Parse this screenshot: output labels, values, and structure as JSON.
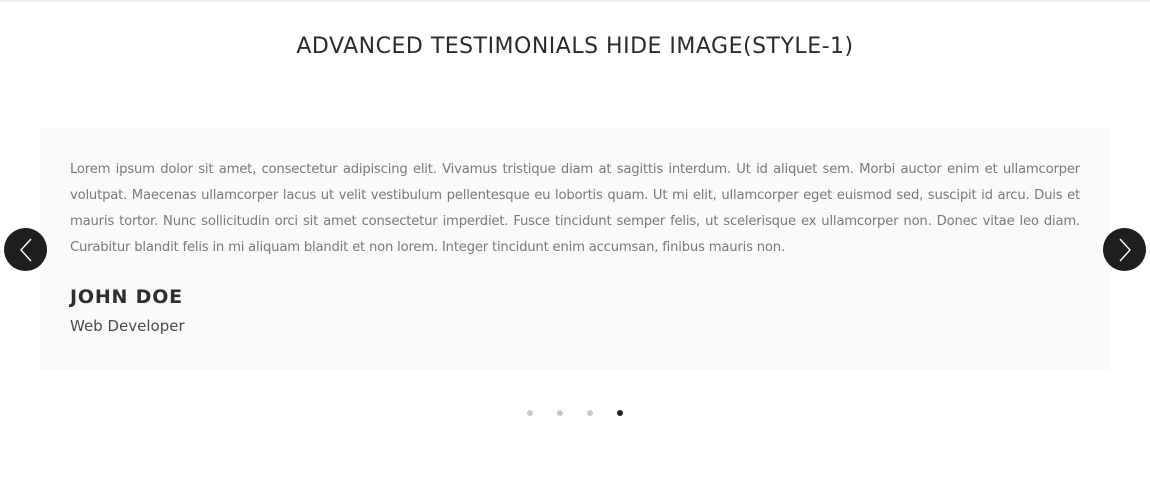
{
  "section": {
    "title": "ADVANCED TESTIMONIALS HIDE IMAGE(STYLE-1)"
  },
  "testimonial": {
    "quote": "Lorem ipsum dolor sit amet, consectetur adipiscing elit. Vivamus tristique diam at sagittis interdum. Ut id aliquet sem. Morbi auctor enim et ullamcorper volutpat. Maecenas ullamcorper lacus ut velit vestibulum pellentesque eu lobortis quam. Ut mi elit, ullamcorper eget euismod sed, suscipit id arcu. Duis et mauris tortor. Nunc sollicitudin orci sit amet consectetur imperdiet. Fusce tincidunt semper felis, ut scelerisque ex ullamcorper non. Donec vitae leo diam. Curabitur blandit felis in mi aliquam blandit et non lorem. Integer tincidunt enim accumsan, finibus mauris non.",
    "name": "JOHN DOE",
    "role": "Web Developer"
  },
  "carousel": {
    "prev_icon": "chevron-left-icon",
    "next_icon": "chevron-right-icon",
    "dot_count": 4,
    "active_index": 3
  },
  "colors": {
    "button_bg": "#1f1d1d",
    "card_bg": "#fafafa",
    "dot_inactive": "#c8c8c8",
    "dot_active": "#222222"
  }
}
